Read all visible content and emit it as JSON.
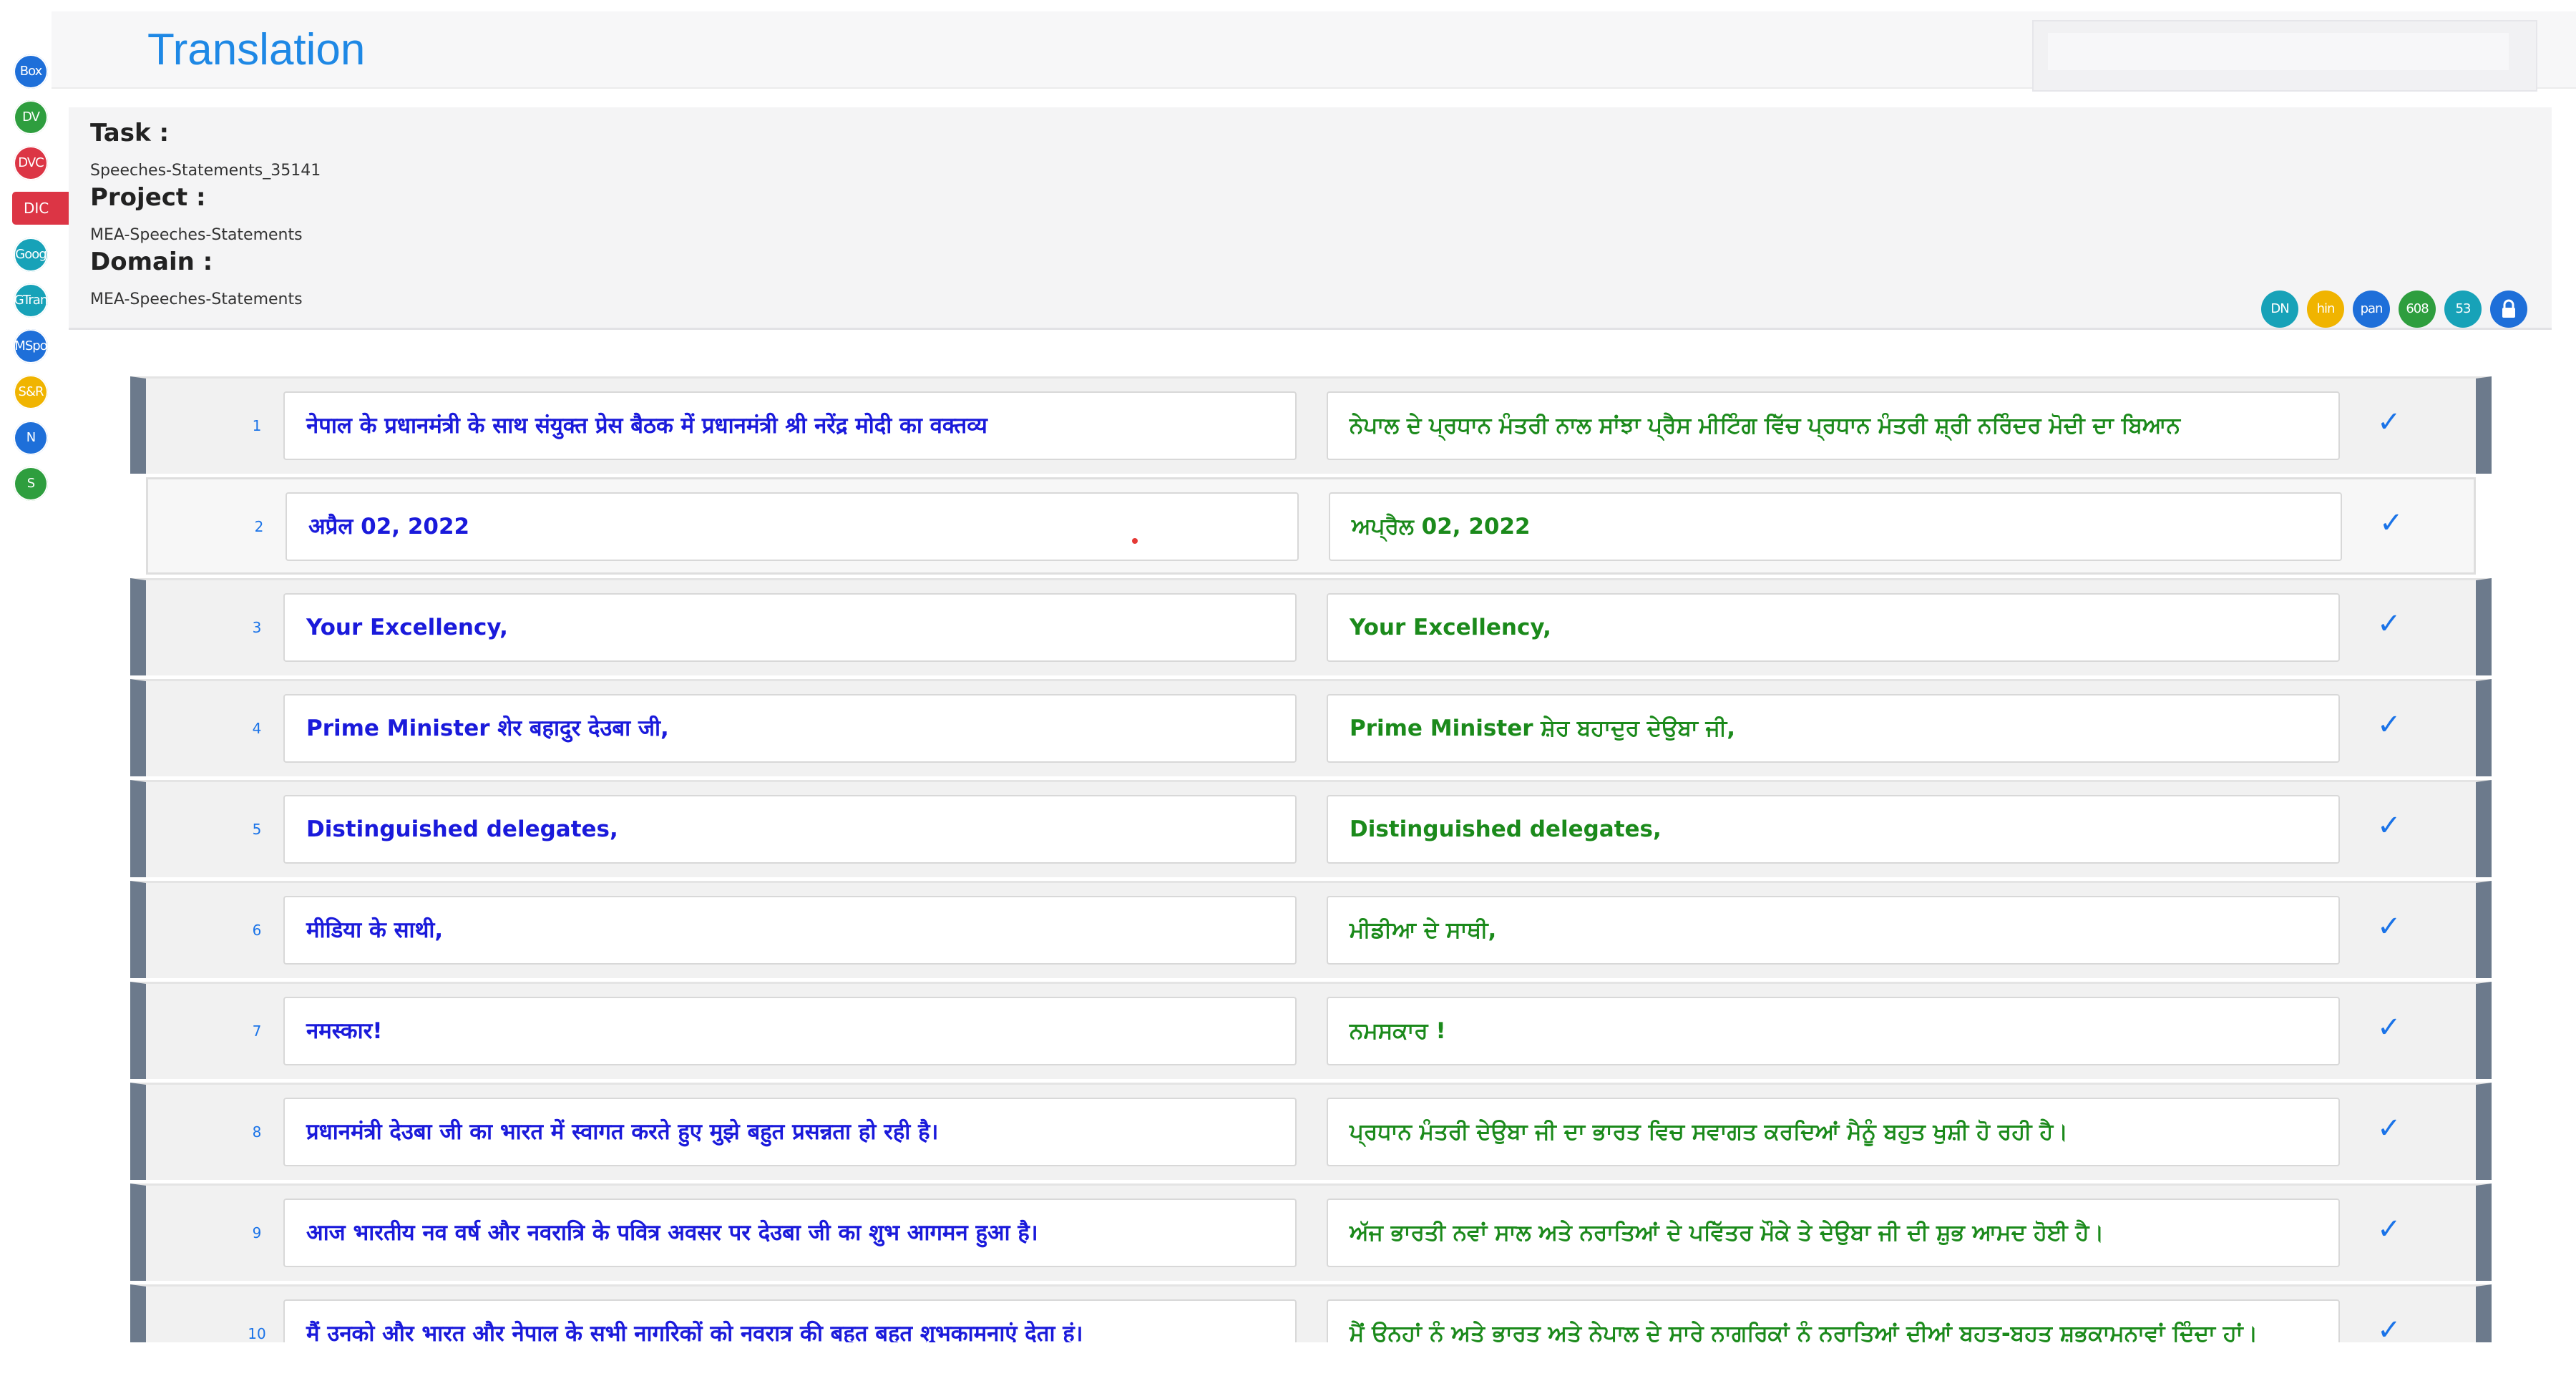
{
  "rail": [
    {
      "label": "Box",
      "color": "#1e6fd9"
    },
    {
      "label": "DV",
      "color": "#2e9e3e"
    },
    {
      "label": "DVC",
      "color": "#dc3545"
    },
    {
      "label": "DIC",
      "color": "#dc3545"
    },
    {
      "label": "Goog",
      "color": "#17a2b8"
    },
    {
      "label": "GTran",
      "color": "#17a2b8"
    },
    {
      "label": "MSpo",
      "color": "#1e6fd9"
    },
    {
      "label": "S&R",
      "color": "#f0b400"
    },
    {
      "label": "N",
      "color": "#1e6fd9"
    },
    {
      "label": "S",
      "color": "#2e9e3e"
    }
  ],
  "header": {
    "title": "Translation",
    "search_placeholder": ""
  },
  "info": {
    "task_label": "Task :",
    "task_value": "Speeches-Statements_35141",
    "project_label": "Project :",
    "project_value": "MEA-Speeches-Statements",
    "domain_label": "Domain :",
    "domain_value": "MEA-Speeches-Statements"
  },
  "badges": [
    {
      "label": "DN",
      "color": "#17a2b8"
    },
    {
      "label": "hin",
      "color": "#f0b400"
    },
    {
      "label": "pan",
      "color": "#1e6fd9"
    },
    {
      "label": "608",
      "color": "#2e9e3e"
    },
    {
      "label": "53",
      "color": "#17a2b8"
    },
    {
      "label": "lock-icon",
      "color": "#1e6fd9"
    }
  ],
  "rows": [
    {
      "n": "1",
      "src": "नेपाल के प्रधानमंत्री के साथ संयुक्त प्रेस बैठक में प्रधानमंत्री श्री नरेंद्र मोदी का वक्तव्य",
      "tgt": "ਨੇਪਾਲ ਦੇ ਪ੍ਰਧਾਨ ਮੰਤਰੀ ਨਾਲ ਸਾਂਝਾ ਪ੍ਰੈਸ ਮੀਟਿੰਗ ਵਿੱਚ ਪ੍ਰਧਾਨ ਮੰਤਰੀ ਸ਼੍ਰੀ ਨਰਿੰਦਰ ਮੋਦੀ ਦਾ ਬਿਆਨ",
      "style": "edge"
    },
    {
      "n": "2",
      "src": "अप्रैल 02, 2022",
      "tgt": "ਅਪ੍ਰੈਲ 02, 2022",
      "style": "plain"
    },
    {
      "n": "3",
      "src": "Your Excellency,",
      "tgt": "Your Excellency,",
      "style": "edge"
    },
    {
      "n": "4",
      "src": "Prime Minister शेर बहादुर देउबा जी,",
      "tgt": "Prime Minister ਸ਼ੇਰ ਬਹਾਦੁਰ ਦੇਉਬਾ ਜੀ,",
      "style": "edge"
    },
    {
      "n": "5",
      "src": "Distinguished delegates,",
      "tgt": "Distinguished delegates,",
      "style": "edge"
    },
    {
      "n": "6",
      "src": "मीडिया के साथी,",
      "tgt": "ਮੀਡੀਆ ਦੇ ਸਾਥੀ,",
      "style": "edge"
    },
    {
      "n": "7",
      "src": "नमस्कार!",
      "tgt": "ਨਮਸਕਾਰ !",
      "style": "edge"
    },
    {
      "n": "8",
      "src": "प्रधानमंत्री देउबा जी का भारत में स्वागत करते हुए मुझे बहुत प्रसन्नता हो रही है।",
      "tgt": "ਪ੍ਰਧਾਨ ਮੰਤਰੀ ਦੇਉਬਾ ਜੀ ਦਾ ਭਾਰਤ ਵਿਚ ਸਵਾਗਤ ਕਰਦਿਆਂ ਮੈਨੂੰ ਬਹੁਤ ਖੁਸ਼ੀ ਹੋ ਰਹੀ ਹੈ।",
      "style": "edge"
    },
    {
      "n": "9",
      "src": "आज भारतीय नव वर्ष और नवरात्रि के पवित्र अवसर पर देउबा जी का शुभ आगमन हुआ है।",
      "tgt": "ਅੱਜ ਭਾਰਤੀ ਨਵਾਂ ਸਾਲ ਅਤੇ ਨਰਾਤਿਆਂ ਦੇ ਪਵਿੱਤਰ ਮੌਕੇ ਤੇ ਦੇਉਬਾ ਜੀ ਦੀ ਸ਼ੁਭ ਆਮਦ ਹੋਈ ਹੈ।",
      "style": "edge"
    },
    {
      "n": "10",
      "src": "मैं उनको और भारत और नेपाल के सभी नागरिकों को नवरात्र की बहुत बहुत शुभकामनाएं देता हूं।",
      "tgt": "ਮੈਂ ਉਨ੍ਹਾਂ ਨੂੰ ਅਤੇ ਭਾਰਤ ਅਤੇ ਨੇਪਾਲ ਦੇ ਸਾਰੇ ਨਾਗਰਿਕਾਂ ਨੂੰ ਨਰਾਤਿਆਂ ਦੀਆਂ ਬਹੁਤ-ਬਹੁਤ ਸ਼ੁਭਕਾਮਨਾਵਾਂ ਦਿੰਦਾ ਹਾਂ।",
      "style": "edge"
    }
  ]
}
